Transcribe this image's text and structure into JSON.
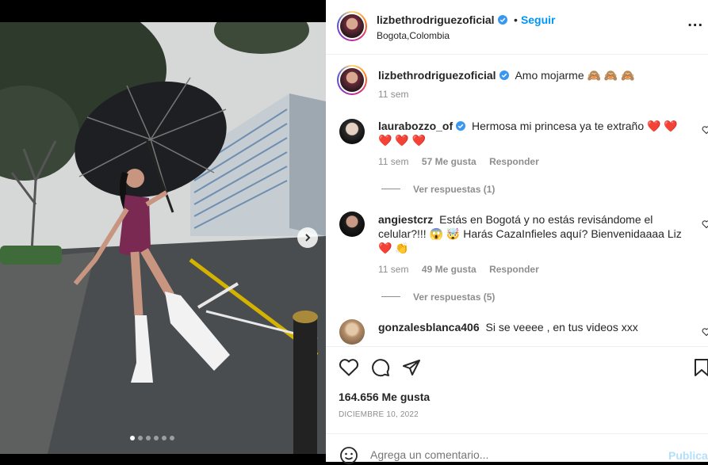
{
  "post": {
    "username": "lizbethrodriguezoficial",
    "follow_label": "Seguir",
    "dot_separator": "•",
    "location": "Bogota,Colombia",
    "more_label": "...",
    "caption": "Amo mojarme 🙈 🙈 🙈",
    "caption_time": "11 sem"
  },
  "comments": [
    {
      "username": "laurabozzo_of",
      "text": "Hermosa mi princesa ya te extraño ❤️ ❤️ ❤️ ❤️ ❤️",
      "time": "11 sem",
      "likes": "57 Me gusta",
      "reply": "Responder",
      "view_replies": "Ver respuestas (1)"
    },
    {
      "username": "angiestcrz",
      "text": "Estás en Bogotá y no estás revisándome el celular?!!! 😱 🤯 Harás CazaInfieles aquí? Bienvenidaaaa Liz ❤️ 👏",
      "time": "11 sem",
      "likes": "49 Me gusta",
      "reply": "Responder",
      "view_replies": "Ver respuestas (5)"
    },
    {
      "username": "gonzalesblanca406",
      "text": "Si se veeee , en tus videos xxx"
    }
  ],
  "stats": {
    "likes": "164.656 Me gusta",
    "date": "DICIEMBRE 10, 2022"
  },
  "add_comment": {
    "placeholder": "Agrega un comentario...",
    "publish": "Publicar"
  },
  "icons": {
    "like": "heart-icon",
    "comment": "comment-icon",
    "share": "share-icon",
    "save": "bookmark-icon",
    "emoji": "emoji-icon",
    "verified": "verified-badge-icon",
    "next": "chevron-right-icon"
  },
  "colors": {
    "accent": "#0095f6",
    "verified": "#3897f0",
    "heart": "#ed4956"
  },
  "carousel": {
    "count": 6,
    "active_index": 0
  }
}
